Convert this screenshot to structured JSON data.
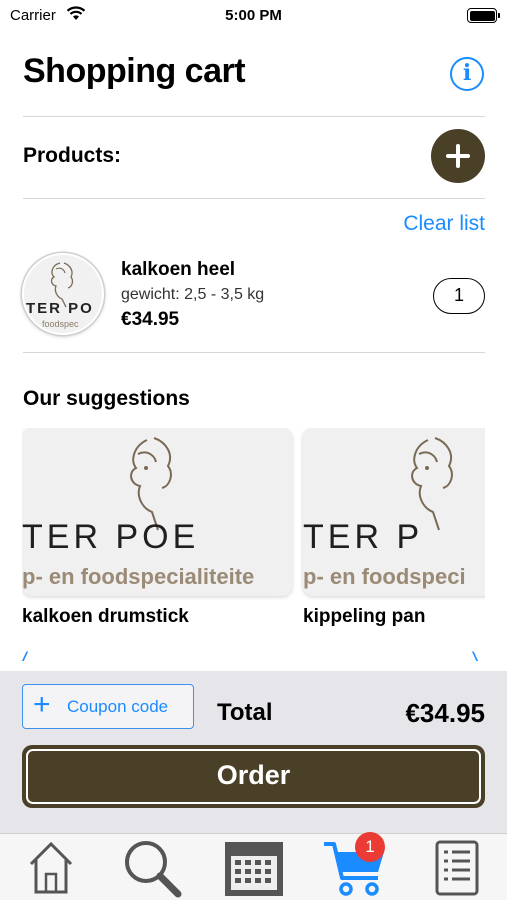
{
  "status_bar": {
    "carrier": "Carrier",
    "time": "5:00 PM"
  },
  "header": {
    "title": "Shopping cart",
    "info_icon": "info-icon"
  },
  "products_section": {
    "label": "Products:",
    "add_icon": "plus-icon",
    "clear_label": "Clear list"
  },
  "cart_items": [
    {
      "name": "kalkoen heel",
      "weight": "gewicht: 2,5 - 3,5 kg",
      "price": "€34.95",
      "quantity": "1",
      "logo_text": "TER PO",
      "logo_sub": "foodspec"
    }
  ],
  "suggestions": {
    "label": "Our suggestions",
    "items": [
      {
        "name": "kalkoen drumstick",
        "logo_text": "TER  POE",
        "logo_sub": "p- en foodspecialiteite"
      },
      {
        "name": "kippeling pan",
        "logo_text": "TER  P",
        "logo_sub": "p- en foodspeci"
      }
    ]
  },
  "footer": {
    "coupon_label": "Coupon code",
    "total_label": "Total",
    "total_value": "€34.95",
    "order_label": "Order"
  },
  "tab_bar": {
    "tabs": [
      {
        "icon": "home-icon"
      },
      {
        "icon": "search-icon"
      },
      {
        "icon": "calendar-icon"
      },
      {
        "icon": "cart-icon",
        "badge": "1",
        "active": true
      },
      {
        "icon": "list-icon"
      }
    ]
  },
  "colors": {
    "accent": "#1a8cff",
    "brand": "#4a4028",
    "badge": "#ea3b34"
  }
}
